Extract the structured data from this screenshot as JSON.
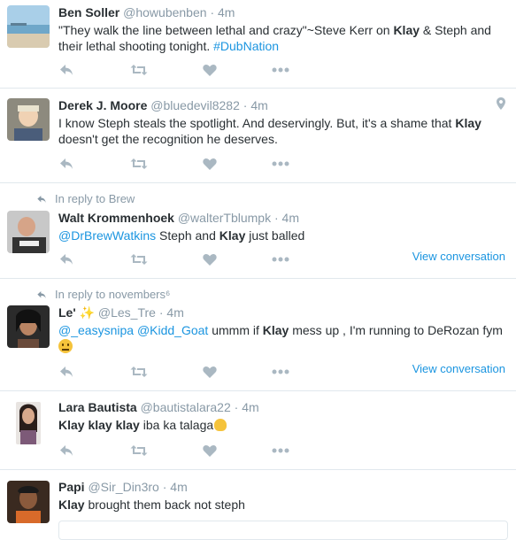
{
  "tweets": [
    {
      "name": "Ben Soller",
      "handle": "@howubenben",
      "sep": "·",
      "time": "4m",
      "text_parts": [
        "\"They walk the line between lethal and crazy\"~Steve Kerr on ",
        "Klay",
        " & Steph and their lethal shooting tonight. ",
        "#DubNation"
      ]
    },
    {
      "name": "Derek J. Moore",
      "handle": "@bluedevil8282",
      "sep": "·",
      "time": "4m",
      "text_parts": [
        "I know Steph steals the spotlight.  And deservingly.  But, it's a shame that ",
        "Klay",
        " doesn't get the recognition he deserves."
      ],
      "location_icon": "map-pin-icon"
    },
    {
      "reply_to": "In reply to Brew",
      "name": "Walt Krommenhoek",
      "handle": "@walterTblumpk",
      "sep": "·",
      "time": "4m",
      "text_parts": [
        "@DrBrewWatkins",
        " Steph and ",
        "Klay",
        " just balled"
      ],
      "view_conversation": "View conversation"
    },
    {
      "reply_to": "In reply to novembers⁶",
      "name": "Le'",
      "name_emoji": "✨",
      "handle": "@Les_Tre",
      "sep": "·",
      "time": "4m",
      "text_parts": [
        "@_easysnipa",
        " ",
        "@Kidd_Goat",
        " ummm if ",
        "Klay",
        " mess up , I'm running to DeRozan fym "
      ],
      "view_conversation": "View conversation"
    },
    {
      "name": "Lara Bautista",
      "handle": "@bautistalara22",
      "sep": "·",
      "time": "4m",
      "text_parts": [
        "Klay klay klay",
        " iba ka talaga"
      ]
    },
    {
      "name": "Papi",
      "handle": "@Sir_Din3ro",
      "sep": "·",
      "time": "4m",
      "text_parts": [
        "Klay",
        " brought them back not steph"
      ]
    }
  ],
  "icons": {
    "reply": "reply-icon",
    "retweet": "retweet-icon",
    "like": "heart-icon",
    "more": "more-icon"
  },
  "colors": {
    "link": "#1b95e0",
    "muted": "#8899a6",
    "text": "#292f33",
    "divider": "#e1e8ed"
  }
}
